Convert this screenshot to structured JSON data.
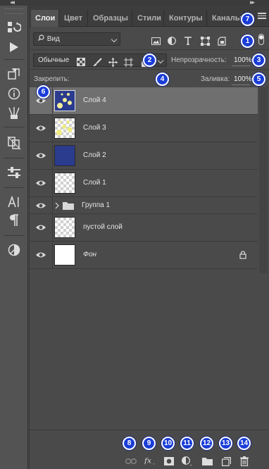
{
  "tabs": [
    {
      "label": "Слои"
    },
    {
      "label": "Цвет"
    },
    {
      "label": "Образцы"
    },
    {
      "label": "Стили"
    },
    {
      "label": "Контуры"
    },
    {
      "label": "Каналы"
    }
  ],
  "filter": {
    "kind_label": "Вид",
    "icons": [
      "image-filter-icon",
      "adjustment-filter-icon",
      "type-filter-icon",
      "shape-filter-icon",
      "smart-object-filter-icon"
    ]
  },
  "blend": {
    "mode_value": "Обычные",
    "opacity_label": "Непрозрачность:",
    "opacity_value": "100%"
  },
  "lock": {
    "label": "Закрепить:",
    "fill_label": "Заливка:",
    "fill_value": "100%"
  },
  "layers": [
    {
      "name": "Слой 4",
      "selected": true,
      "thumb": "blue-dots"
    },
    {
      "name": "Слой 3",
      "selected": false,
      "thumb": "checker-dots"
    },
    {
      "name": "Слой 2",
      "selected": false,
      "thumb": "blue"
    },
    {
      "name": "Слой 1",
      "selected": false,
      "thumb": "checker"
    },
    {
      "name": "Группа 1",
      "type": "group"
    },
    {
      "name": "пустой слой",
      "selected": false,
      "thumb": "checker"
    },
    {
      "name": "Фон",
      "selected": false,
      "thumb": "white",
      "locked": true
    }
  ],
  "bottom_icons": [
    "link-layers-icon",
    "fx-icon",
    "add-mask-icon",
    "adjustment-layer-icon",
    "new-group-icon",
    "new-layer-icon",
    "delete-layer-icon"
  ],
  "badges": [
    "1",
    "2",
    "3",
    "4",
    "5",
    "6",
    "7",
    "8",
    "9",
    "10",
    "11",
    "12",
    "13",
    "14"
  ],
  "colors": {
    "badge": "#1a3dd8",
    "panel": "#4a4a4a",
    "selected_row": "#6f6f6f",
    "layer_blue": "#2b3c8e"
  }
}
